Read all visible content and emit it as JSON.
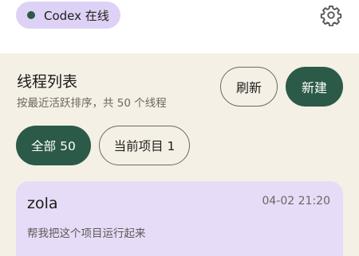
{
  "status": {
    "text": "Codex 在线",
    "dot_color": "#2b5a48",
    "icon": "status-dot-icon"
  },
  "header": {
    "settings_icon": "gear-icon"
  },
  "threads": {
    "title": "线程列表",
    "subtitle": "按最近活跃排序，共 50 个线程",
    "refresh_label": "刷新",
    "new_label": "新建"
  },
  "filters": {
    "all_label": "全部 50",
    "current_label": "当前项目 1",
    "selected": "全部 50"
  },
  "thread_items": [
    {
      "name": "zola",
      "time": "04-02 21:20",
      "preview": "帮我把这个项目运行起来"
    }
  ],
  "colors": {
    "accent": "#2b5a48",
    "background": "#f4f0e6",
    "card": "#e6dcf8",
    "status_pill": "#ddd2f6"
  }
}
